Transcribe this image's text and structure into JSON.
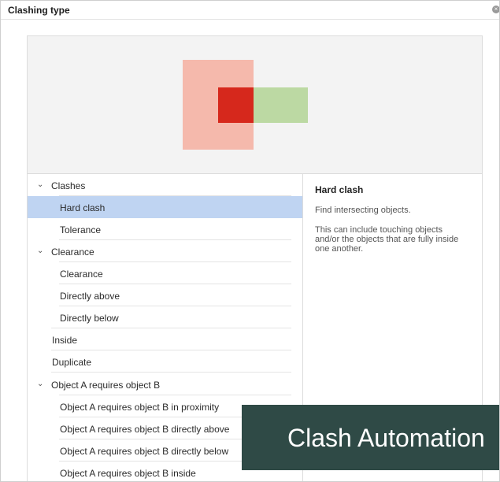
{
  "dialog": {
    "title": "Clashing type",
    "close_icon": "close-icon"
  },
  "preview": {
    "colors": {
      "object_a": "#f5b9ac",
      "object_b": "#bcd9a3",
      "overlap": "#d6281c"
    }
  },
  "tree": {
    "items": [
      {
        "label": "Clashes",
        "expandable": true
      },
      {
        "label": "Hard clash",
        "selected": true
      },
      {
        "label": "Tolerance"
      },
      {
        "label": "Clearance",
        "expandable": true
      },
      {
        "label": "Clearance"
      },
      {
        "label": "Directly above"
      },
      {
        "label": "Directly below"
      },
      {
        "label": "Inside"
      },
      {
        "label": "Duplicate"
      },
      {
        "label": "Object A requires object B",
        "expandable": true
      },
      {
        "label": "Object A requires object B in proximity"
      },
      {
        "label": "Object A requires object B directly above"
      },
      {
        "label": "Object A requires object B directly below"
      },
      {
        "label": "Object A requires object B inside"
      }
    ],
    "selection_color": "#bfd4f2"
  },
  "detail": {
    "title": "Hard clash",
    "summary": "Find intersecting objects.",
    "description": "This can include touching objects and/or the objects that are fully inside one another."
  },
  "overlay": {
    "text": "Clash Automation",
    "background": "#2f4a46"
  }
}
